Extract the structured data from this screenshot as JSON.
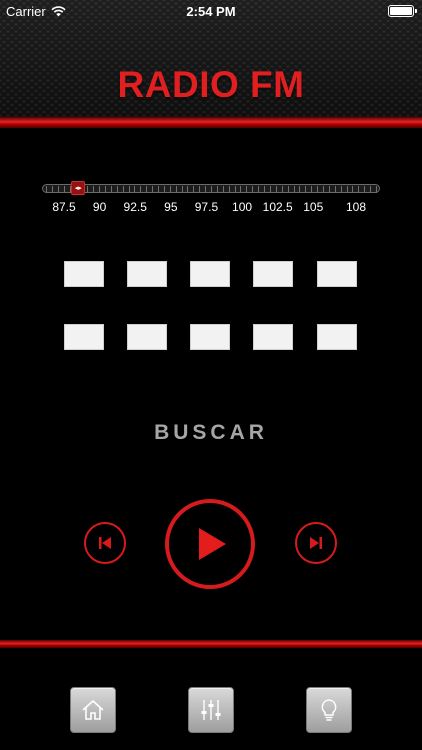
{
  "status": {
    "carrier": "Carrier",
    "time": "2:54 PM"
  },
  "app": {
    "title": "RADIO FM"
  },
  "tuner": {
    "frequency_labels": [
      "87.5",
      "90",
      "92.5",
      "95",
      "97.5",
      "100",
      "102.5",
      "105",
      "108"
    ],
    "current_frequency": 88.5,
    "min": 87.5,
    "max": 108
  },
  "presets": [
    {
      "row": 1,
      "label": ""
    },
    {
      "row": 1,
      "label": ""
    },
    {
      "row": 1,
      "label": ""
    },
    {
      "row": 1,
      "label": ""
    },
    {
      "row": 1,
      "label": ""
    },
    {
      "row": 2,
      "label": ""
    },
    {
      "row": 2,
      "label": ""
    },
    {
      "row": 2,
      "label": ""
    },
    {
      "row": 2,
      "label": ""
    },
    {
      "row": 2,
      "label": ""
    }
  ],
  "search": {
    "label": "BUSCAR"
  },
  "controls": {
    "previous_icon": "skip-previous-icon",
    "play_icon": "play-icon",
    "next_icon": "skip-next-icon"
  },
  "toolbar": {
    "items": [
      {
        "icon": "home-icon"
      },
      {
        "icon": "equalizer-icon"
      },
      {
        "icon": "lightbulb-icon"
      }
    ]
  },
  "colors": {
    "accent": "#e02020",
    "background": "#000000",
    "search_text": "#a6a6a6"
  }
}
